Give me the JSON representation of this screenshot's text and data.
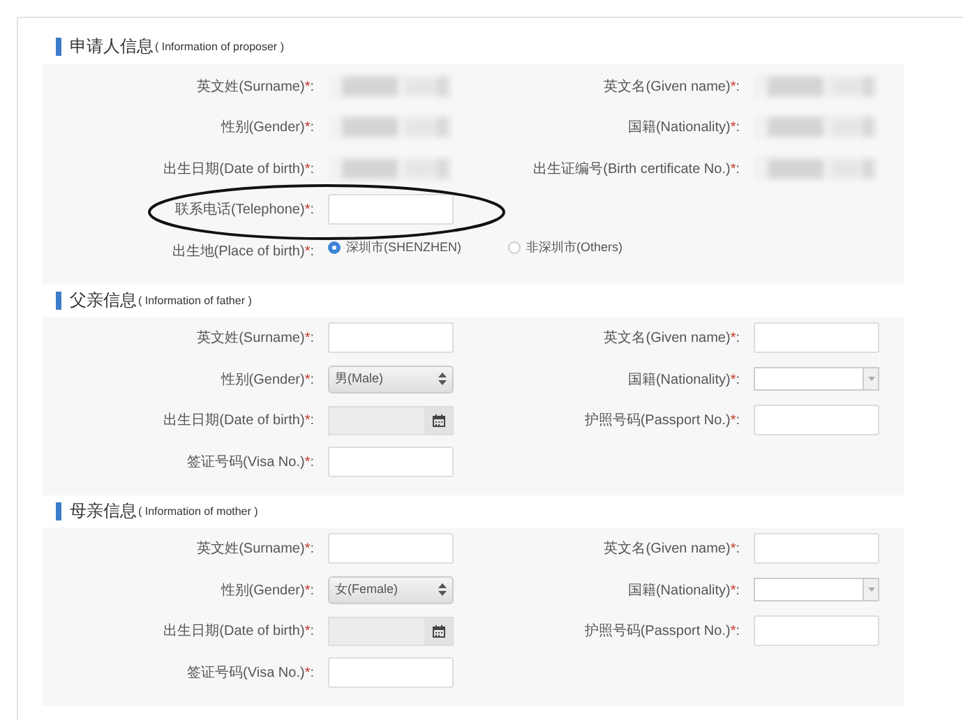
{
  "sections": [
    {
      "title": "申请人信息",
      "subtitle": "( Information of proposer )",
      "rows": [
        [
          {
            "label": "英文姓(Surname)",
            "star": "*",
            "colon": ":",
            "kind": "redacted"
          },
          {
            "label": "英文名(Given name)",
            "star": "*",
            "colon": ":",
            "kind": "redacted"
          }
        ],
        [
          {
            "label": "性别(Gender)",
            "star": "*",
            "colon": ":",
            "kind": "redacted"
          },
          {
            "label": "国籍(Nationality)",
            "star": "*",
            "colon": ":",
            "kind": "redacted"
          }
        ],
        [
          {
            "label": "出生日期(Date of birth)",
            "star": "*",
            "colon": ":",
            "kind": "redacted"
          },
          {
            "label": "出生证编号(Birth certificate No.)",
            "star": "*",
            "colon": ":",
            "kind": "redacted"
          }
        ],
        [
          {
            "label": "联系电话(Telephone)",
            "star": "*",
            "colon": ":",
            "kind": "text",
            "circled": true
          }
        ],
        [
          {
            "label": "出生地(Place of birth)",
            "star": "*",
            "colon": ":",
            "kind": "radio",
            "options": [
              {
                "label": "深圳市(SHENZHEN)",
                "selected": true
              },
              {
                "label": "非深圳市(Others)",
                "selected": false
              }
            ]
          }
        ]
      ]
    },
    {
      "title": "父亲信息",
      "subtitle": "( Information of father )",
      "rows": [
        [
          {
            "label": "英文姓(Surname)",
            "star": "*",
            "colon": ":",
            "kind": "text"
          },
          {
            "label": "英文名(Given name)",
            "star": "*",
            "colon": ":",
            "kind": "text"
          }
        ],
        [
          {
            "label": "性别(Gender)",
            "star": "*",
            "colon": ":",
            "kind": "select",
            "value": "男(Male)"
          },
          {
            "label": "国籍(Nationality)",
            "star": "*",
            "colon": ":",
            "kind": "combo"
          }
        ],
        [
          {
            "label": "出生日期(Date of birth)",
            "star": "*",
            "colon": ":",
            "kind": "date"
          },
          {
            "label": "护照号码(Passport No.)",
            "star": "*",
            "colon": ":",
            "kind": "text"
          }
        ],
        [
          {
            "label": "签证号码(Visa No.)",
            "star": "*",
            "colon": ":",
            "kind": "text"
          }
        ]
      ]
    },
    {
      "title": "母亲信息",
      "subtitle": "( Information of mother )",
      "rows": [
        [
          {
            "label": "英文姓(Surname)",
            "star": "*",
            "colon": ":",
            "kind": "text"
          },
          {
            "label": "英文名(Given name)",
            "star": "*",
            "colon": ":",
            "kind": "text"
          }
        ],
        [
          {
            "label": "性别(Gender)",
            "star": "*",
            "colon": ":",
            "kind": "select",
            "value": "女(Female)"
          },
          {
            "label": "国籍(Nationality)",
            "star": "*",
            "colon": ":",
            "kind": "combo"
          }
        ],
        [
          {
            "label": "出生日期(Date of birth)",
            "star": "*",
            "colon": ":",
            "kind": "date"
          },
          {
            "label": "护照号码(Passport No.)",
            "star": "*",
            "colon": ":",
            "kind": "text"
          }
        ],
        [
          {
            "label": "签证号码(Visa No.)",
            "star": "*",
            "colon": ":",
            "kind": "text"
          }
        ]
      ]
    }
  ]
}
